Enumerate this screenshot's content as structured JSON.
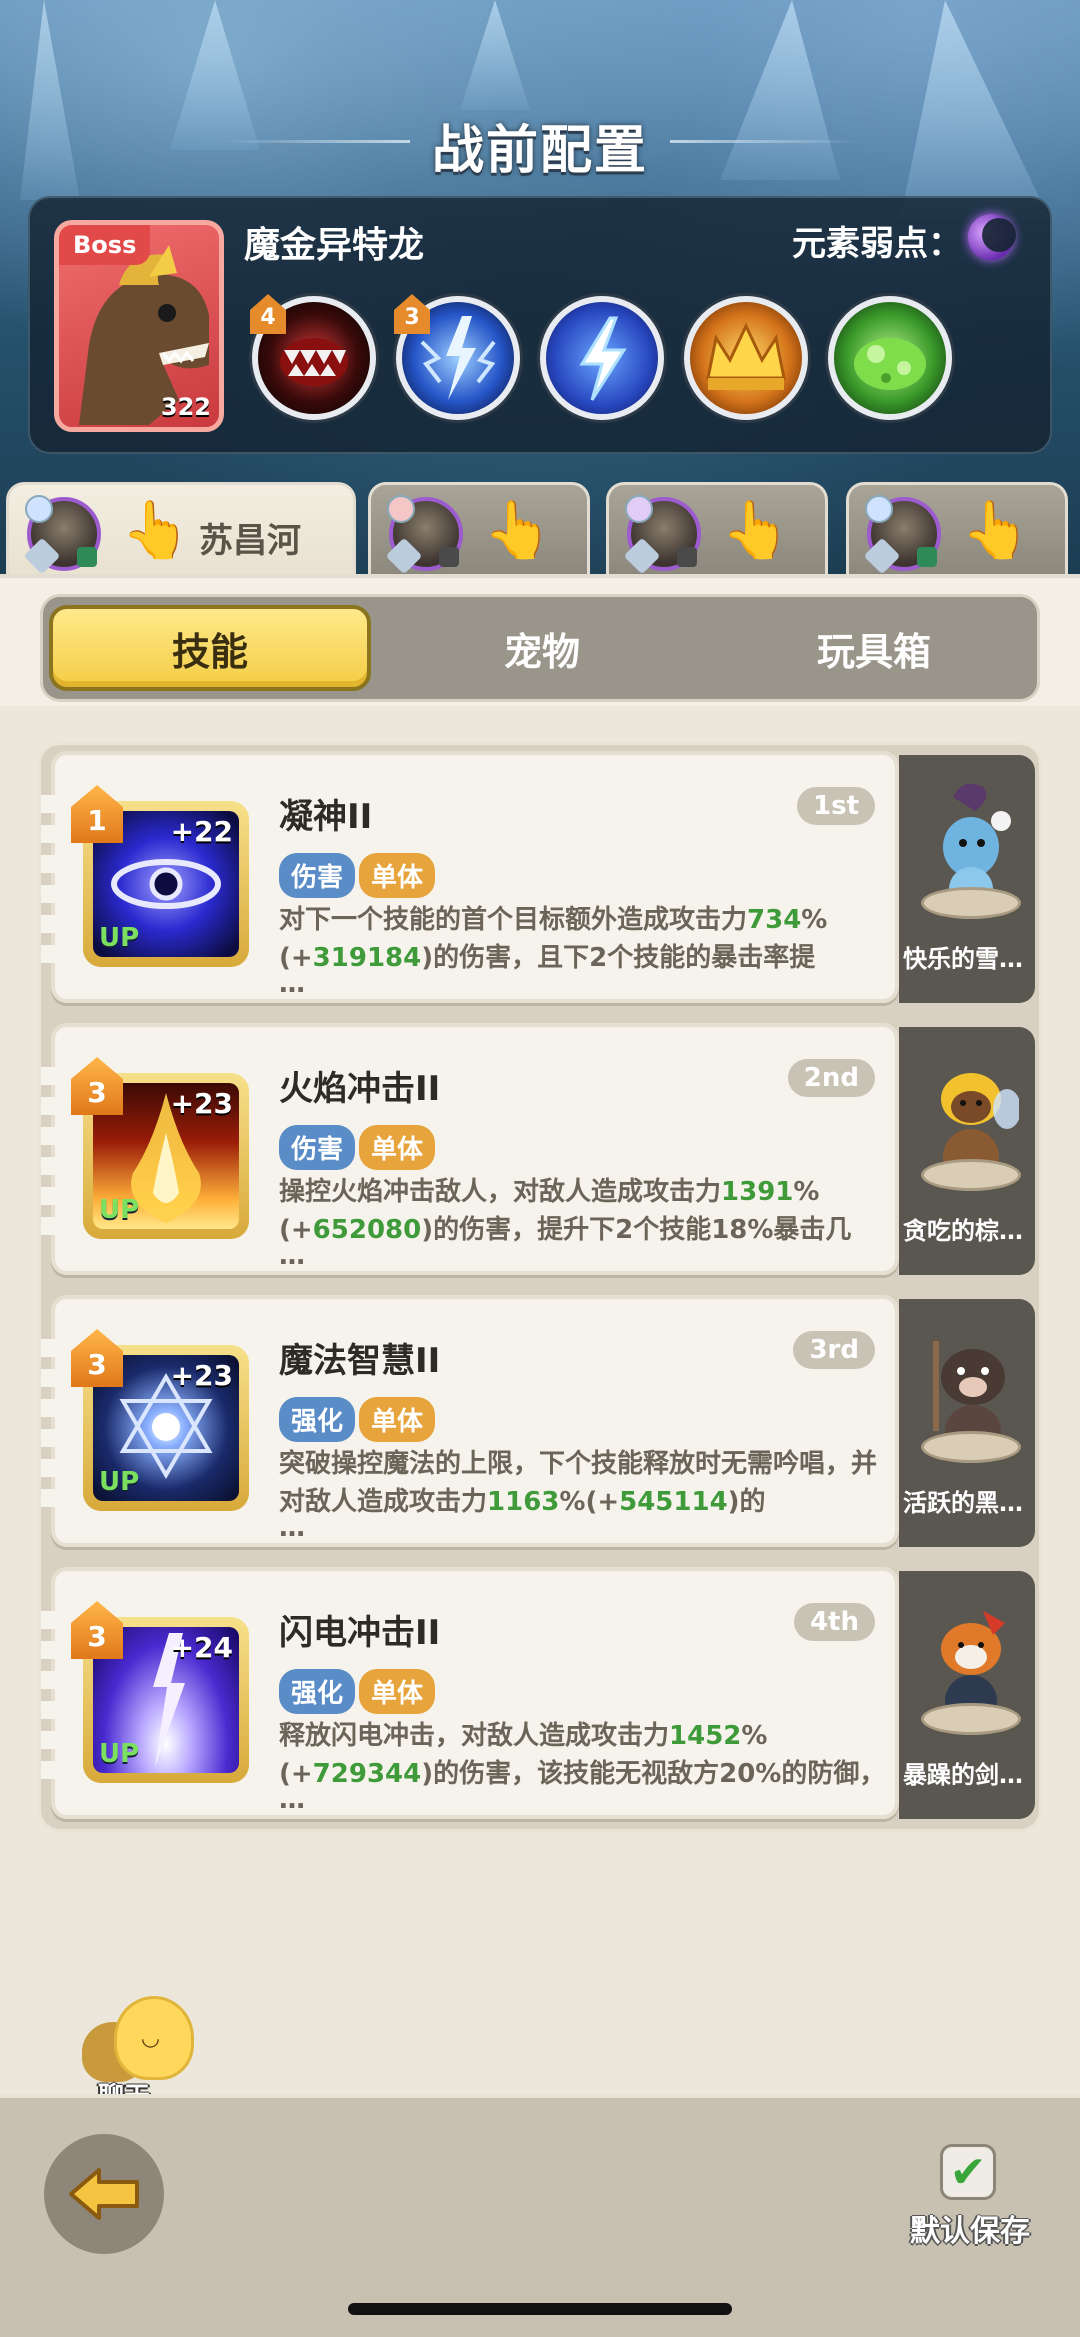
{
  "title": "战前配置",
  "boss": {
    "tag": "Boss",
    "level": "322",
    "name": "魔金异特龙",
    "weakness_label": "元素弱点：",
    "weakness_icon": "moon-icon",
    "skills": [
      {
        "icon": "fang-mouth-icon",
        "badge": "4",
        "color": "#7a1a1a"
      },
      {
        "icon": "lightning-burst-icon",
        "badge": "3",
        "color": "#1e4fb8"
      },
      {
        "icon": "lightning-bolt-icon",
        "badge": "",
        "color": "#2b54c9"
      },
      {
        "icon": "golden-crown-spikes-icon",
        "badge": "",
        "color": "#c66a12"
      },
      {
        "icon": "green-slime-icon",
        "badge": "",
        "color": "#3a8f2a"
      }
    ]
  },
  "players": [
    {
      "name": "苏昌河",
      "active": true,
      "element": "blue"
    },
    {
      "name": "",
      "active": false,
      "element": "red"
    },
    {
      "name": "",
      "active": false,
      "element": "purple"
    },
    {
      "name": "",
      "active": false,
      "element": "blue"
    }
  ],
  "tabs": [
    "技能",
    "宠物",
    "玩具箱"
  ],
  "skills": [
    {
      "name": "凝神II",
      "order": "1st",
      "level": "1",
      "plus": "+22",
      "up": "UP",
      "tags": [
        "伤害",
        "单体"
      ],
      "desc_pre": "对下一个技能的首个目标额外造成攻击力",
      "desc_val1": "734",
      "desc_mid1": "%(+",
      "desc_val2": "319184",
      "desc_post": ")的伤害，且下2个技能的暴击率提",
      "more": "…",
      "icon_colors": [
        "#2a2ad0",
        "#0c0c40"
      ],
      "pet_name": "快乐的雪…",
      "pet_color": "#6fb4e0"
    },
    {
      "name": "火焰冲击II",
      "order": "2nd",
      "level": "3",
      "plus": "+23",
      "up": "UP",
      "tags": [
        "伤害",
        "单体"
      ],
      "desc_pre": "操控火焰冲击敌人，对敌人造成攻击力",
      "desc_val1": "1391",
      "desc_mid1": "%(+",
      "desc_val2": "652080",
      "desc_post": ")的伤害，提升下2个技能18%暴击几",
      "more": "…",
      "icon_colors": [
        "#ffd24a",
        "#9a1c08"
      ],
      "pet_name": "贪吃的棕…",
      "pet_color": "#8a5a32"
    },
    {
      "name": "魔法智慧II",
      "order": "3rd",
      "level": "3",
      "plus": "+23",
      "up": "UP",
      "tags": [
        "强化",
        "单体"
      ],
      "desc_pre": "突破操控魔法的上限，下个技能释放时无需吟唱，并对敌人造成攻击力",
      "desc_val1": "1163",
      "desc_mid1": "%(+",
      "desc_val2": "545114",
      "desc_post": ")的",
      "more": "…",
      "icon_colors": [
        "#bcd8ff",
        "#101a40"
      ],
      "pet_name": "活跃的黑…",
      "pet_color": "#4a3a34"
    },
    {
      "name": "闪电冲击II",
      "order": "4th",
      "level": "3",
      "plus": "+24",
      "up": "UP",
      "tags": [
        "强化",
        "单体"
      ],
      "desc_pre": "释放闪电冲击，对敌人造成攻击力",
      "desc_val1": "1452",
      "desc_mid1": "%(+",
      "desc_val2": "729344",
      "desc_post": ")的伤害，该技能无视敌方20%的防御，",
      "more": "…",
      "icon_colors": [
        "#d6c8ff",
        "#2a1a9a"
      ],
      "pet_name": "暴躁的剑…",
      "pet_color": "#e07a2a"
    }
  ],
  "chat_label": "聊天",
  "save_label": "默认保存",
  "back_icon": "back-arrow-icon",
  "colors": {
    "accent_yellow": "#f4cd45",
    "value_green": "#3f9b3a"
  }
}
